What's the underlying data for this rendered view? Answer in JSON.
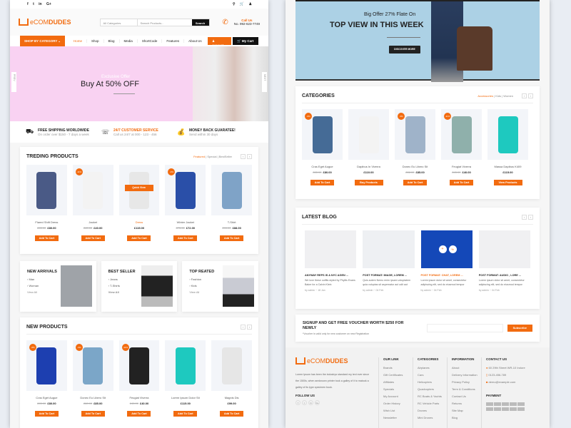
{
  "brand": {
    "logo_prefix": "e",
    "logo_mid": "COM",
    "logo_suffix": "DUDES",
    "accent": "#f26b0f"
  },
  "topbar": {
    "social": [
      "f",
      "t",
      "in",
      "G+"
    ],
    "icons": [
      "search-icon",
      "cart-icon",
      "user-icon"
    ]
  },
  "header": {
    "search": {
      "category": "All Categories",
      "placeholder": "Search Products...",
      "button": "Search"
    },
    "call": {
      "label": "Call Us",
      "number": "No. 992-623-7749"
    }
  },
  "nav": {
    "shop_by": "SHOP BY CATEGORY",
    "links": [
      "Home",
      "Shop",
      "Blog",
      "Media",
      "ShortCode",
      "Features",
      "About Us"
    ],
    "active": "Home",
    "account": "Account",
    "cart": "My Cart"
  },
  "hero": {
    "kicker": "Exclusive Offer",
    "title": "Buy At 50% OFF",
    "prev": "PREV",
    "next": "NEXT"
  },
  "features": [
    {
      "title": "FREE SHIPPING WORLDWIDE",
      "sub": "On order over $150 - 7 days a week",
      "icon": "truck-icon"
    },
    {
      "title": "24/7 CUSTOMER SERVICE",
      "sub": "Call us 24/7 at 000 - 123 - 456",
      "icon": "headset-icon"
    },
    {
      "title": "MONEY BACK GUARATEE!",
      "sub": "Send within 30 days",
      "icon": "money-bag-icon"
    }
  ],
  "trending": {
    "title": "TREDING PRODUCTS",
    "tabs": [
      "Featured",
      "Special",
      "BestSeller"
    ],
    "products": [
      {
        "name": "Flared Shift Dress",
        "old": "£85.00",
        "price": "£80.00",
        "badge": "",
        "button": "Add To Cart",
        "color": "#4a5a86"
      },
      {
        "name": "Jacket",
        "old": "£45.00",
        "price": "£40.00",
        "badge": "-11%",
        "button": "Add To Cart",
        "color": "#f3f3f3"
      },
      {
        "name": "Dress",
        "old": "",
        "price": "£115.00",
        "badge": "",
        "button": "Add To Cart",
        "color": "#e7e7e7",
        "quick": "Quick View"
      },
      {
        "name": "Winter Jacket",
        "old": "£75.00",
        "price": "£72.00",
        "badge": "-4%",
        "button": "Add To Cart",
        "color": "#2a4fa8"
      },
      {
        "name": "T-Shirt",
        "old": "£99.00",
        "price": "£88.00",
        "badge": "",
        "button": "Add To Cart",
        "color": "#7fa3c7"
      }
    ]
  },
  "minis": [
    {
      "title": "NEW ARRIVALS",
      "items": [
        "Man",
        "Woman"
      ],
      "link": "View All",
      "color": "#9fa3a8"
    },
    {
      "title": "BEST SELLER",
      "items": [
        "Jeans",
        "T-Shirts"
      ],
      "link": "View All",
      "color": "#222"
    },
    {
      "title": "TOP REATED",
      "items": [
        "Fashion",
        "Kids"
      ],
      "link": "View All",
      "color": "#c9cbd3"
    }
  ],
  "new_products": {
    "title": "NEW PRODUCTS",
    "products": [
      {
        "name": "Cras Eget Augue",
        "old": "£85.00",
        "price": "£80.00",
        "badge": "-6%",
        "button": "Add To Cart",
        "color": "#1d3fb0"
      },
      {
        "name": "Donec Eu Libero Sit",
        "old": "£88.00",
        "price": "£85.00",
        "badge": "-3%",
        "button": "Add To Cart",
        "color": "#7ba6c8"
      },
      {
        "name": "Feugiat Viverra",
        "old": "£45.00",
        "price": "£40.00",
        "badge": "-11%",
        "button": "Add To Cart",
        "color": "#222"
      },
      {
        "name": "Lorem Ipsum Dolor Sit",
        "old": "",
        "price": "£115.00",
        "badge": "",
        "button": "Add To Cart",
        "color": "#1ec9bf"
      },
      {
        "name": "Magnis Dis",
        "old": "",
        "price": "£99.00",
        "badge": "",
        "button": "Add To Cart",
        "color": "#e6e6e6"
      }
    ]
  },
  "hero2": {
    "sub": "Big Offer 27% Flate On",
    "title": "TOP VIEW IN THIS WEEK",
    "button": "DISCOVER MORE"
  },
  "categories": {
    "title": "CATEGORIES",
    "tabs": [
      "Accessories",
      "Kids",
      "Women"
    ],
    "products": [
      {
        "name": "Cras Eget Augue",
        "old": "£85.00",
        "price": "£80.00",
        "badge": "-6%",
        "button": "Add To Cart",
        "color": "#456b96"
      },
      {
        "name": "Dapibus In Viverra",
        "old": "",
        "price": "£110.00",
        "badge": "",
        "button": "Buy Products",
        "color": "#f3f3f3"
      },
      {
        "name": "Donec Eu Libero Sit",
        "old": "£88.00",
        "price": "£85.00",
        "badge": "-3%",
        "button": "Add To Cart",
        "color": "#9fb3c9"
      },
      {
        "name": "Feugiat Viverra",
        "old": "£45.00",
        "price": "£40.00",
        "badge": "-11%",
        "button": "Add To Cart",
        "color": "#8fb0ab"
      },
      {
        "name": "Massa Dapibus K409",
        "old": "",
        "price": "£115.00",
        "badge": "",
        "button": "View Products",
        "color": "#1ec9bf"
      }
    ]
  },
  "blog": {
    "title": "LATEST BLOG",
    "posts": [
      {
        "title": "ANYWAY REPS IS A NYC AGEN ...",
        "text": "We love these outfits styled by Phyllis Evans Baker for a Calvin Klein",
        "by": "by admin",
        "date": "18 Jan",
        "color": "#f0f0f2"
      },
      {
        "title": "POST FORMAT: IMAGE, LOREM ...",
        "text": "Quis autem Nemo enim ipsam voluptatem quia voluptas sit aspernatur aut odit aut",
        "by": "by admin",
        "date": "04 Feb",
        "color": "#eef0f3"
      },
      {
        "title": "POST FORMAT: CHAT, LOREM ...",
        "text": "Lorem ipsum dolor sit amet, consectetur adipiscing elit, sed do eiusmod tempor",
        "by": "by admin",
        "date": "04 Feb",
        "color": "#1448b8",
        "active": true
      },
      {
        "title": "POST FORMAT: AUDIO , LORE ...",
        "text": "Lorem ipsum dolor sit amet, consectetur adipiscing elit, sed do eiusmod tempor",
        "by": "by admin",
        "date": "04 Feb",
        "color": "#f0f0f2"
      }
    ]
  },
  "signup": {
    "title": "SIGNUP AND GET FREE VOUCHER WORTH $250 FOR NEWLY",
    "note": "*Voucher is valid only for new customer on new Registration",
    "button": "Subscribe"
  },
  "footer": {
    "about": "Lorem Ipsum has been the industrys standard my text ever since the 1500s, when annknown printer took a galley of it to matook a galley of its type specimen book.",
    "follow": "FOLLOW US",
    "social": [
      "f",
      "t",
      "in",
      "G+"
    ],
    "our_link": {
      "title": "OUR LINK",
      "items": [
        "Brands",
        "Gift Certificates",
        "Affiliates",
        "Specials",
        "My Account",
        "Order History",
        "Wish List",
        "Newsletter"
      ]
    },
    "categories": {
      "title": "CATEGORIES",
      "items": [
        "Airplanes",
        "Cars",
        "Helicopters",
        "Quadcopters",
        "RC Boats & Yachts",
        "RC Vehicle Parts",
        "Drones",
        "Mini Drones"
      ]
    },
    "information": {
      "title": "INFORMATION",
      "items": [
        "About",
        "Delivery Information",
        "Privacy Policy",
        "Term & Conditions",
        "Contact Us",
        "Returns",
        "Site Map",
        "Blog"
      ]
    },
    "contact": {
      "title": "CONTACT US",
      "address": "60 29th Street WR-10 Indore",
      "phone": "0123-456-789",
      "email": "demo@example.com"
    },
    "payment": {
      "title": "PAYMENT",
      "count": 10
    }
  }
}
